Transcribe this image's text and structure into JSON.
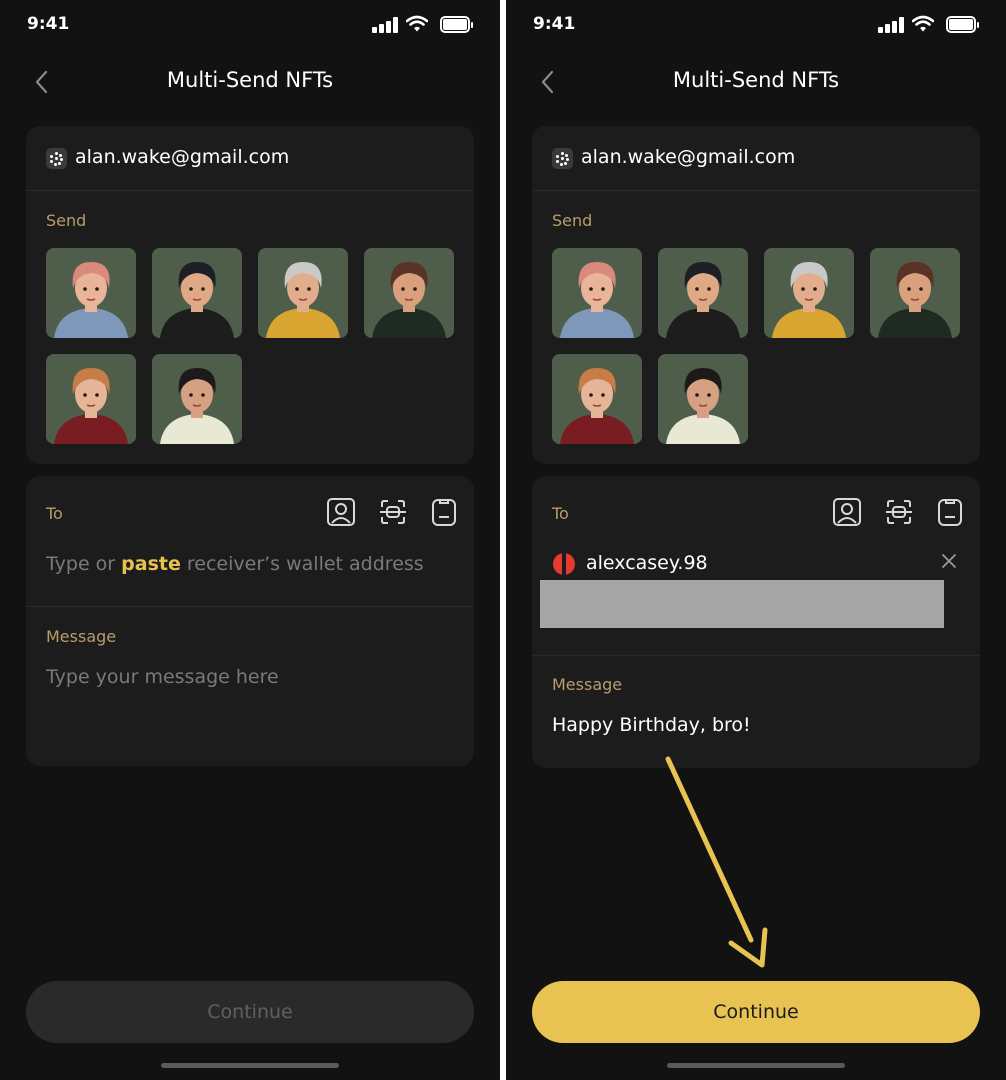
{
  "screens": [
    {
      "status_time": "9:41",
      "title": "Multi-Send NFTs",
      "sender_email": "alan.wake@gmail.com",
      "send_label": "Send",
      "to_label": "To",
      "address_placeholder_prefix": "Type or ",
      "address_placeholder_paste": "paste",
      "address_placeholder_suffix": " receiver’s wallet address",
      "message_label": "Message",
      "message_placeholder": "Type your message here",
      "continue_label": "Continue",
      "continue_state": "disabled"
    },
    {
      "status_time": "9:41",
      "title": "Multi-Send NFTs",
      "sender_email": "alan.wake@gmail.com",
      "send_label": "Send",
      "to_label": "To",
      "recipient_name": "alexcasey.98",
      "message_label": "Message",
      "message_text": "Happy Birthday, bro!",
      "continue_label": "Continue",
      "continue_state": "active"
    }
  ],
  "nfts": [
    {
      "name": "pink-haired-woman-avatar",
      "hair": "#d98a7c",
      "skin": "#e8b59a",
      "clothes": "#7f97b8"
    },
    {
      "name": "black-haired-man-avatar",
      "hair": "#1c2026",
      "skin": "#e0a985",
      "clothes": "#1d1d1d"
    },
    {
      "name": "cap-man-avatar",
      "hair": "#c9c9c9",
      "skin": "#e2ad8c",
      "clothes": "#d9a531"
    },
    {
      "name": "brown-haired-man-avatar",
      "hair": "#5a3226",
      "skin": "#d9a07e",
      "clothes": "#1e2a22"
    },
    {
      "name": "curly-blonde-woman-avatar",
      "hair": "#c97d46",
      "skin": "#e6b497",
      "clothes": "#7a1d22"
    },
    {
      "name": "beanie-woman-avatar",
      "hair": "#1f1a1a",
      "skin": "#d6a183",
      "clothes": "#e8e8d4"
    }
  ],
  "icons": [
    "back-chevron-icon",
    "contacts-icon",
    "scan-icon",
    "clipboard-icon",
    "close-icon",
    "signal-icon",
    "wifi-icon",
    "battery-icon"
  ],
  "colors": {
    "background": "#121212",
    "card": "#1c1c1c",
    "accent": "#e8c352",
    "label": "#b99d6b",
    "nft_background": "#4e5e4b"
  }
}
